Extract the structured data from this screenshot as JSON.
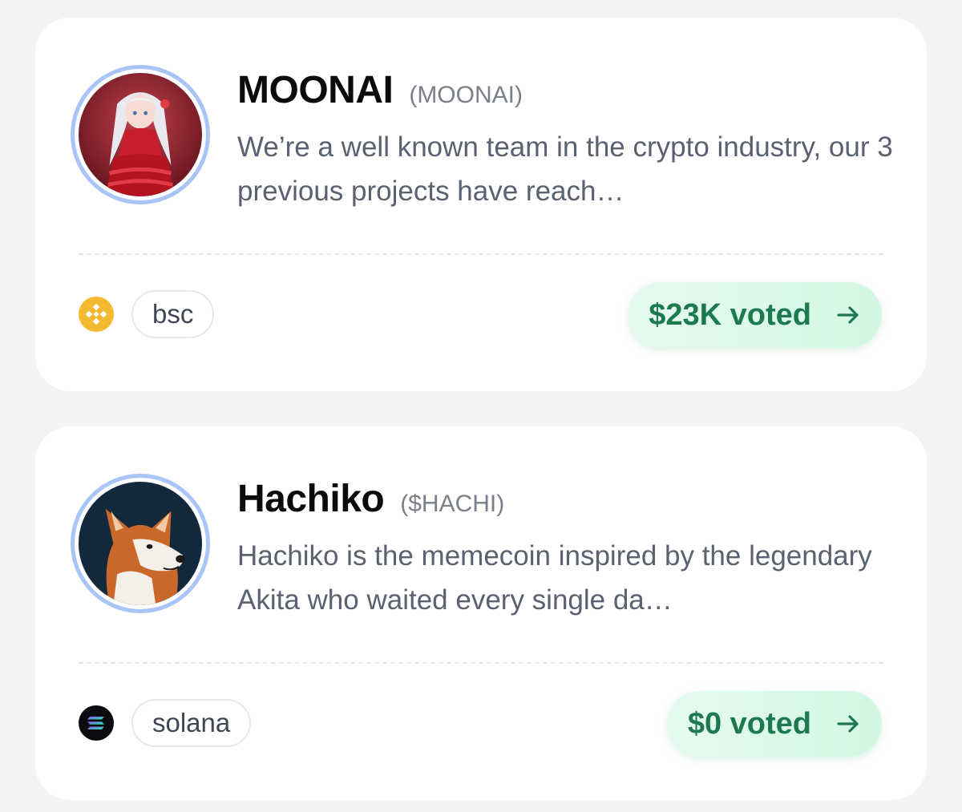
{
  "projects": [
    {
      "name": "MOONAI",
      "ticker": "(MOONAI)",
      "description": "We’re a well known team in the crypto industry, our 3 previous projects have reach…",
      "chain": "bsc",
      "chain_icon": "bnb-icon",
      "vote_label": "$23K voted",
      "accent": "#1d7a4e"
    },
    {
      "name": "Hachiko",
      "ticker": "($HACHI)",
      "description": "Hachiko is the memecoin inspired by the legendary Akita who waited every single da…",
      "chain": "solana",
      "chain_icon": "solana-icon",
      "vote_label": "$0 voted",
      "accent": "#1d7a4e"
    }
  ],
  "colors": {
    "background": "#f3f4f6",
    "card": "#ffffff",
    "avatar_ring": "#a9c4f7",
    "vote_bg": "#dcf8e8",
    "vote_text": "#1d7a4e",
    "bnb": "#f3ba2f"
  }
}
